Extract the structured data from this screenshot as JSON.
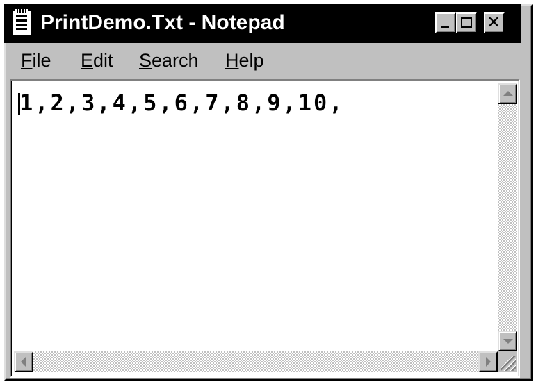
{
  "window": {
    "title": "PrintDemo.Txt - Notepad"
  },
  "caption_buttons": {
    "minimize_icon": "minimize-icon",
    "maximize_icon": "maximize-icon",
    "close_icon": "close-icon",
    "close_glyph": "✕"
  },
  "menu": {
    "file": {
      "accel": "F",
      "rest": "ile"
    },
    "edit": {
      "accel": "E",
      "rest": "dit"
    },
    "search": {
      "accel": "S",
      "rest": "earch"
    },
    "help": {
      "accel": "H",
      "rest": "elp"
    }
  },
  "document": {
    "text": "1,2,3,4,5,6,7,8,9,10,"
  },
  "colors": {
    "titlebar": "#000000",
    "title_text": "#ffffff",
    "face": "#c0c0c0",
    "edit_background": "#ffffff"
  }
}
